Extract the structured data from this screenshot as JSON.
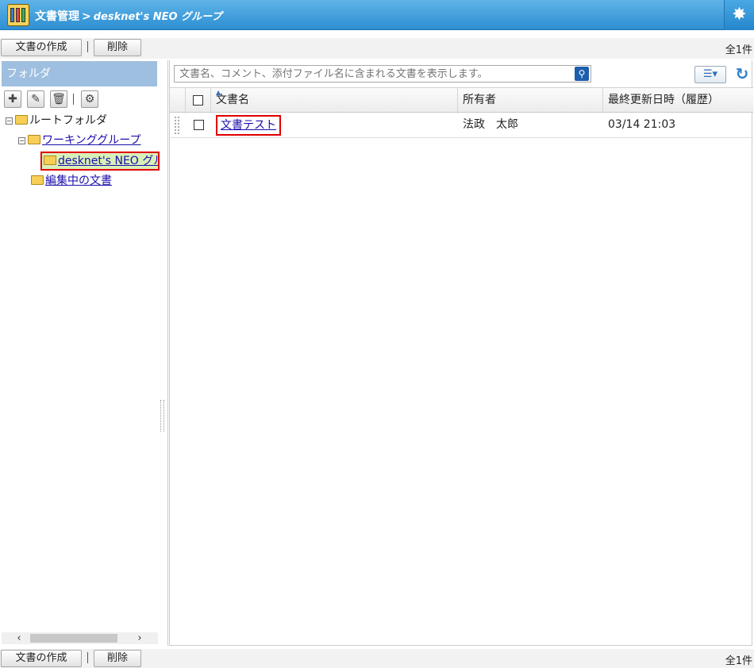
{
  "header": {
    "title": "文書管理",
    "separator": ">",
    "subtitle": "desknet's NEO グループ"
  },
  "toolbar": {
    "create_label": "文書の作成",
    "delete_label": "削除",
    "count": "全1件"
  },
  "sidebar": {
    "heading": "フォルダ",
    "tree": {
      "root": "ルートフォルダ",
      "working": "ワーキンググループ",
      "selected": "desknet's NEO グル",
      "editing": "編集中の文書"
    }
  },
  "search": {
    "placeholder": "文書名、コメント、添付ファイル名に含まれる文書を表示します。"
  },
  "table": {
    "columns": [
      "文書名",
      "所有者",
      "最終更新日時（履歴）"
    ],
    "rows": [
      {
        "name": "文書テスト",
        "owner": "法政　太郎",
        "updated": "03/14 21:03"
      }
    ]
  },
  "colors": {
    "header_blue": "#2d8fd2",
    "folder_panel": "#9fbfe1",
    "selected_bg": "#d8f0b8",
    "highlight_red": "#e00000"
  }
}
